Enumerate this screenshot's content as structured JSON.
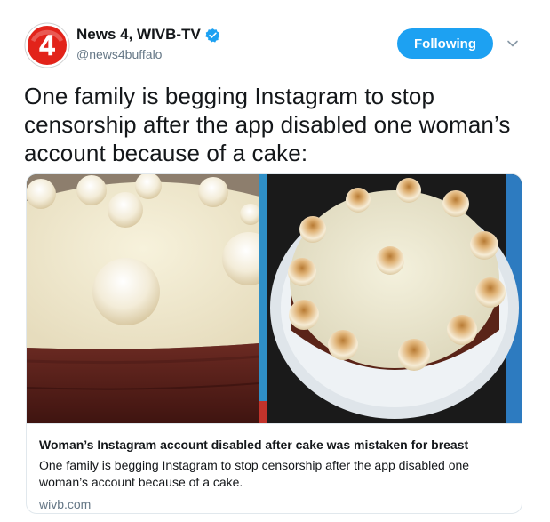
{
  "tweet": {
    "display_name": "News 4, WIVB-TV",
    "handle": "@news4buffalo",
    "follow_label": "Following",
    "avatar_text": "4",
    "text": "One family is begging Instagram to stop censorship after the app disabled one woman’s account because of a cake:"
  },
  "card": {
    "title": "Woman’s Instagram account disabled after cake was mistaken for breast",
    "description": "One family is begging Instagram to stop censorship after the app disabled one woman’s account because of a cake.",
    "domain": "wivb.com"
  },
  "colors": {
    "accent": "#1da1f2",
    "text": "#14171a",
    "secondary": "#657786",
    "logo_red": "#e2231a"
  },
  "icons": {
    "verified": "verified-badge-icon",
    "caret": "chevron-down-icon"
  }
}
